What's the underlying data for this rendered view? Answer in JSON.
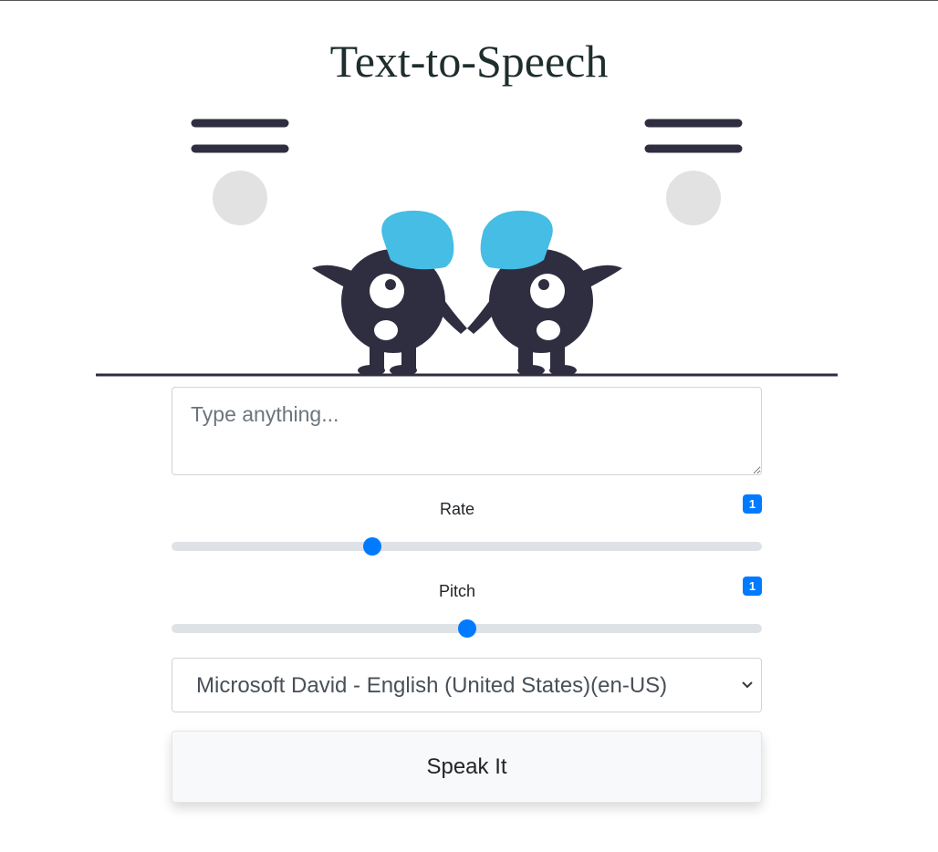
{
  "title": "Text-to-Speech",
  "illustration": {
    "palette": {
      "dark": "#2f2e41",
      "accent": "#45bde4",
      "light": "#e2e2e2",
      "white": "#ffffff"
    }
  },
  "form": {
    "text_placeholder": "Type anything...",
    "text_value": "",
    "rate": {
      "label": "Rate",
      "value": "1",
      "fraction": 0.34
    },
    "pitch": {
      "label": "Pitch",
      "value": "1",
      "fraction": 0.5
    },
    "voice": {
      "selected": "Microsoft David - English (United States)(en-US)"
    },
    "speak_label": "Speak It"
  },
  "colors": {
    "accent": "#007bff",
    "track": "#dee2e6"
  }
}
